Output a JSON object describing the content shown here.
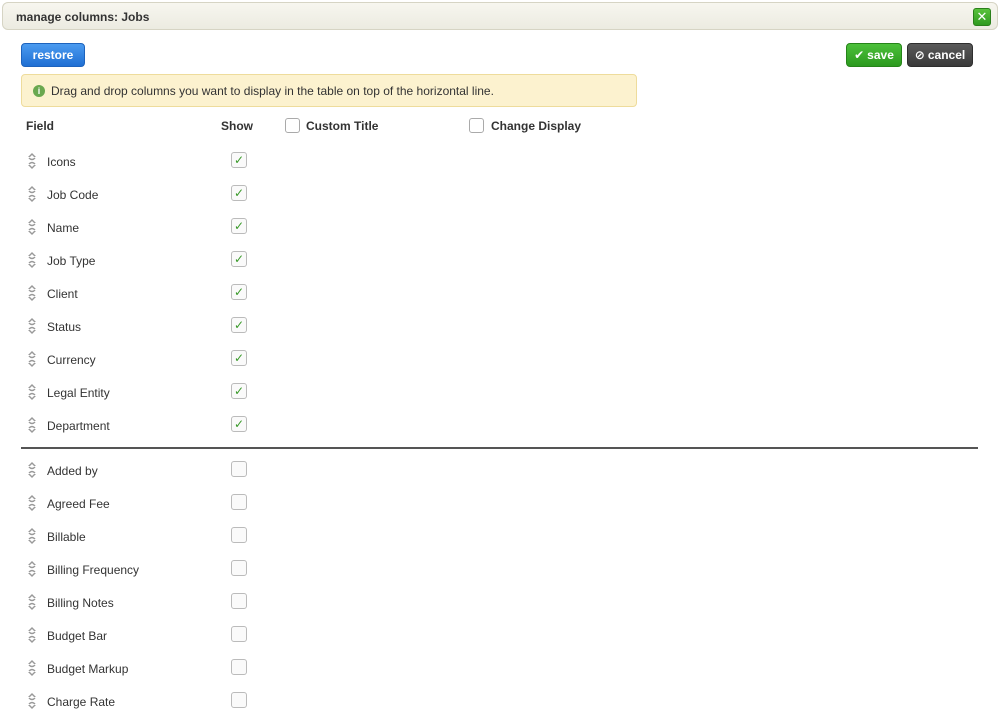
{
  "dialog": {
    "title": "manage columns: Jobs",
    "close_icon": "close-icon",
    "accent_close": "#3aa52a"
  },
  "toolbar": {
    "restore_label": "restore",
    "save_label": "save",
    "cancel_label": "cancel",
    "colors": {
      "restore": "#2f80e0",
      "save": "#35a827",
      "cancel": "#444444"
    }
  },
  "info": {
    "text": "Drag and drop columns you want to display in the table on top of the horizontal line.",
    "icon": "info-icon"
  },
  "headers": {
    "field": "Field",
    "show": "Show",
    "custom_title": "Custom Title",
    "change_display": "Change Display"
  },
  "visible_columns": [
    {
      "label": "Icons",
      "checked": true
    },
    {
      "label": "Job Code",
      "checked": true
    },
    {
      "label": "Name",
      "checked": true
    },
    {
      "label": "Job Type",
      "checked": true
    },
    {
      "label": "Client",
      "checked": true
    },
    {
      "label": "Status",
      "checked": true
    },
    {
      "label": "Currency",
      "checked": true
    },
    {
      "label": "Legal Entity",
      "checked": true
    },
    {
      "label": "Department",
      "checked": true
    }
  ],
  "hidden_columns": [
    {
      "label": "Added by",
      "checked": false
    },
    {
      "label": "Agreed Fee",
      "checked": false
    },
    {
      "label": "Billable",
      "checked": false
    },
    {
      "label": "Billing Frequency",
      "checked": false
    },
    {
      "label": "Billing Notes",
      "checked": false
    },
    {
      "label": "Budget Bar",
      "checked": false
    },
    {
      "label": "Budget Markup",
      "checked": false
    },
    {
      "label": "Charge Rate",
      "checked": false
    }
  ]
}
